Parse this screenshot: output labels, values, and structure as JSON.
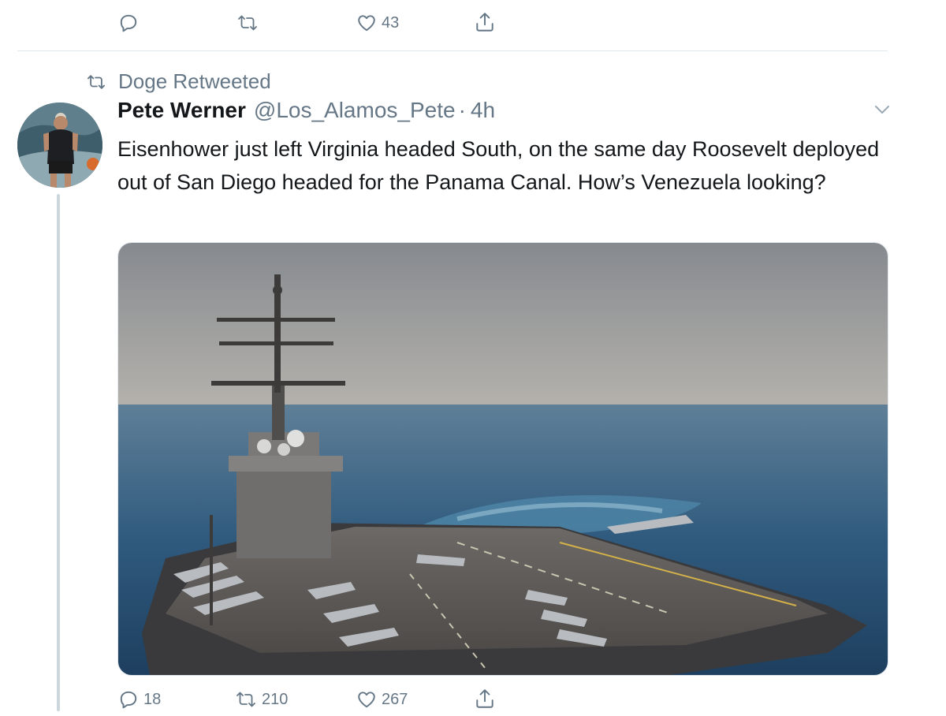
{
  "prev_tweet": {
    "actions": {
      "reply_count": "",
      "retweet_count": "",
      "like_count": "43"
    }
  },
  "retweet_context": {
    "label": "Doge Retweeted"
  },
  "tweet": {
    "author_name": "Pete Werner",
    "handle": "@Los_Alamos_Pete",
    "separator": "·",
    "time": "4h",
    "text": "Eisenhower just left Virginia headed South, on the same day Roosevelt deployed out of San Diego headed for the Panama Canal.  How’s Venezuela looking?",
    "actions": {
      "reply_count": "18",
      "retweet_count": "210",
      "like_count": "267"
    }
  },
  "icons": {
    "reply": "reply-icon",
    "retweet": "retweet-icon",
    "like": "heart-icon",
    "share": "share-icon",
    "more": "chevron-down-icon"
  },
  "colors": {
    "text_primary": "#14171a",
    "text_secondary": "#657786",
    "divider": "#e1e8ed",
    "thread_line": "#ccd6dd"
  }
}
